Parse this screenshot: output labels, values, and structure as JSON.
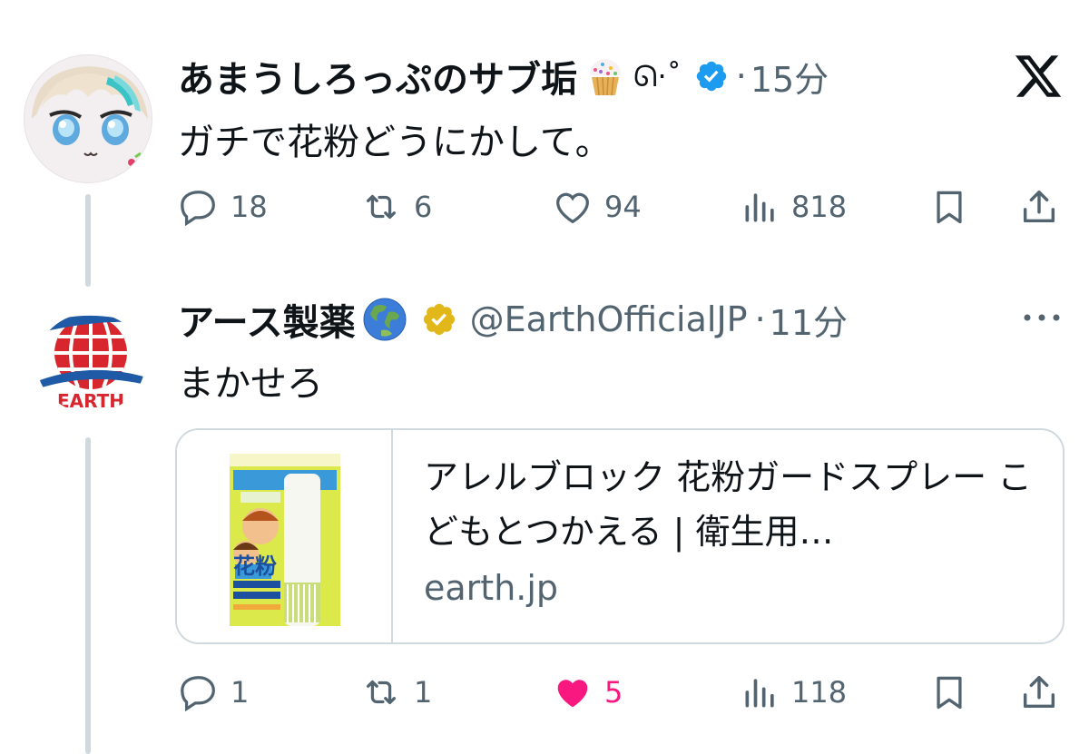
{
  "tweet_1": {
    "display_name": "あまうしろっぷのサブ垢",
    "name_kaomoji": "ᘏ·˚",
    "time": "15分",
    "text": "ガチで花粉どうにかして。",
    "stats": {
      "replies": "18",
      "reposts": "6",
      "likes": "94",
      "views": "818"
    },
    "verified_color": "#1d9bf0"
  },
  "tweet_2": {
    "display_name": "アース製薬",
    "handle": "@EarthOfficialJP",
    "time": "11分",
    "text": "まかせろ",
    "stats": {
      "replies": "1",
      "reposts": "1",
      "likes": "5",
      "views": "118"
    },
    "verified_color": "#e2b719",
    "avatar_logo_text": "EARTH"
  },
  "link_card": {
    "title": "アレルブロック 花粉ガードスプレー こどもとつかえる | 衛生用…",
    "domain": "earth.jp"
  },
  "icons": {
    "reply": "speech-bubble-icon",
    "repost": "repost-arrows-icon",
    "like": "heart-icon",
    "views": "bar-chart-icon",
    "bookmark": "bookmark-icon",
    "share": "share-upload-icon",
    "platform": "x-logo-icon",
    "more": "more-dots-icon"
  },
  "colors": {
    "like_active": "#f91880",
    "secondary_text": "#536471",
    "line": "#cfd9de"
  }
}
